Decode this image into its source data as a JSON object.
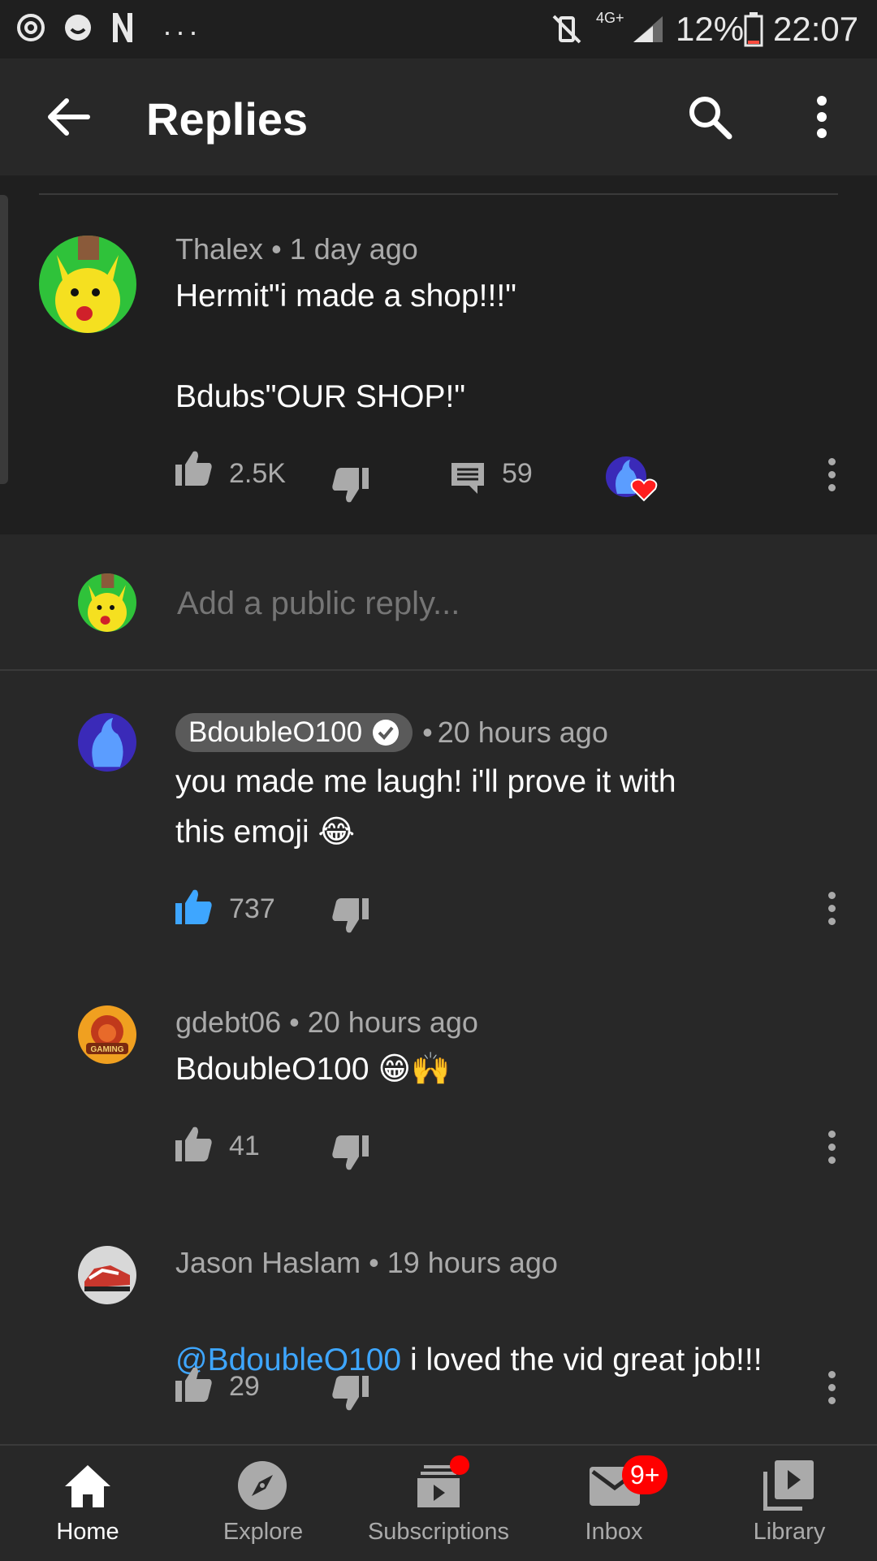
{
  "status_bar": {
    "battery": "12%",
    "time": "22:07",
    "network": "4G+"
  },
  "app_bar": {
    "title": "Replies",
    "back_icon": "back-arrow-icon",
    "search_icon": "search-icon",
    "more_icon": "more-vert-icon"
  },
  "top_comment": {
    "author": "Thalex",
    "time": "1 day ago",
    "text": "Hermit\"i made a shop!!!\"\n\nBdubs\"OUR SHOP!\"",
    "likes": "2.5K",
    "replies": "59"
  },
  "reply_box": {
    "placeholder": "Add a public reply..."
  },
  "replies": [
    {
      "author": "BdoubleO100",
      "time": "20 hours ago",
      "text_line1": "you made me laugh! i'll prove it with",
      "text_line2": "this emoji 😂",
      "likes": "737",
      "verified": true,
      "liked": true
    },
    {
      "author": "gdebt06",
      "time": "20 hours ago",
      "text": "BdoubleO100 😁🙌",
      "likes": "41",
      "avatar_text": "GAMING"
    },
    {
      "author": "Jason Haslam",
      "time": "19 hours ago",
      "mention": "@BdoubleO100",
      "text": " i loved the vid great job!!!",
      "likes": "29"
    }
  ],
  "bottom_nav": {
    "items": [
      {
        "label": "Home",
        "icon": "home-icon"
      },
      {
        "label": "Explore",
        "icon": "compass-icon"
      },
      {
        "label": "Subscriptions",
        "icon": "subscriptions-icon"
      },
      {
        "label": "Inbox",
        "icon": "inbox-icon",
        "badge": "9+"
      },
      {
        "label": "Library",
        "icon": "library-icon"
      }
    ]
  },
  "colors": {
    "background": "#282828",
    "accent_blue": "#3ea6ff",
    "badge_red": "#ff0000"
  }
}
